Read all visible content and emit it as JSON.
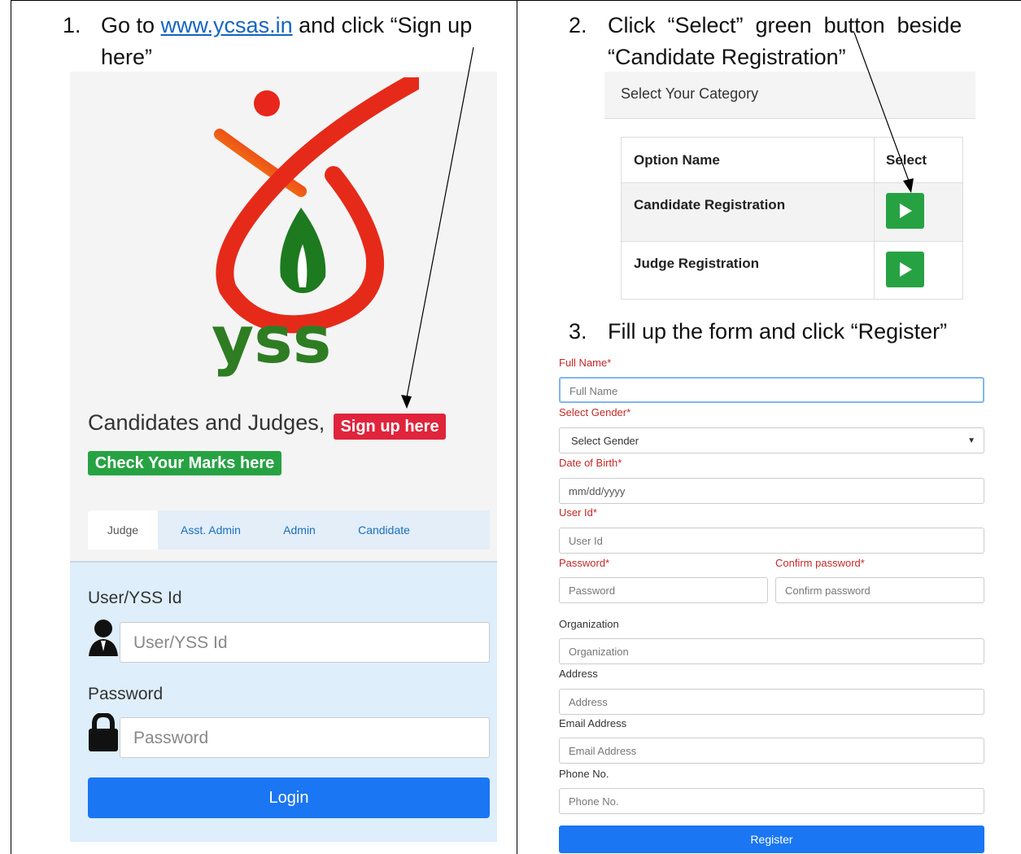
{
  "steps": {
    "step1": {
      "num": "1.",
      "text_before": "Go to ",
      "link": "www.ycsas.in",
      "text_after_line1": " and click “Sign up",
      "text_line2": "here”"
    },
    "step2": {
      "num": "2.",
      "line1": "Click  “Select”  green  button  beside",
      "line2": "“Candidate Registration”"
    },
    "step3": {
      "num": "3.",
      "text": "Fill up the form and click “Register”"
    }
  },
  "login_page": {
    "logo_text": "yss",
    "tagline": "Candidates and Judges,",
    "signup_badge": "Sign up here",
    "marks_badge": "Check Your Marks here",
    "tabs": [
      "Judge",
      "Asst. Admin",
      "Admin",
      "Candidate"
    ],
    "user_label": "User/YSS Id",
    "user_placeholder": "User/YSS Id",
    "password_label": "Password",
    "password_placeholder": "Password",
    "login_button": "Login"
  },
  "category_page": {
    "header": "Select Your Category",
    "col_option": "Option Name",
    "col_select": "Select",
    "rows": [
      "Candidate Registration",
      "Judge Registration"
    ]
  },
  "register_form": {
    "full_name_label": "Full Name*",
    "full_name_placeholder": "Full Name",
    "gender_label": "Select Gender*",
    "gender_value": "Select Gender",
    "dob_label": "Date of Birth*",
    "dob_placeholder": "mm/dd/yyyy",
    "userid_label": "User Id*",
    "userid_placeholder": "User Id",
    "password_label": "Password*",
    "password_placeholder": "Password",
    "confirm_label": "Confirm password*",
    "confirm_placeholder": "Confirm password",
    "org_label": "Organization",
    "org_placeholder": "Organization",
    "address_label": "Address",
    "address_placeholder": "Address",
    "email_label": "Email Address",
    "email_placeholder": "Email Address",
    "phone_label": "Phone No.",
    "phone_placeholder": "Phone No.",
    "register_button": "Register"
  },
  "colors": {
    "signup_red": "#e0243b",
    "green": "#27a243",
    "blue": "#1a76f2",
    "link_blue": "#1565c0",
    "label_red": "#c62828"
  },
  "icons": [
    "person-icon",
    "lock-icon",
    "play-icon",
    "dropdown-caret-icon",
    "arrow-pointer-icon"
  ]
}
